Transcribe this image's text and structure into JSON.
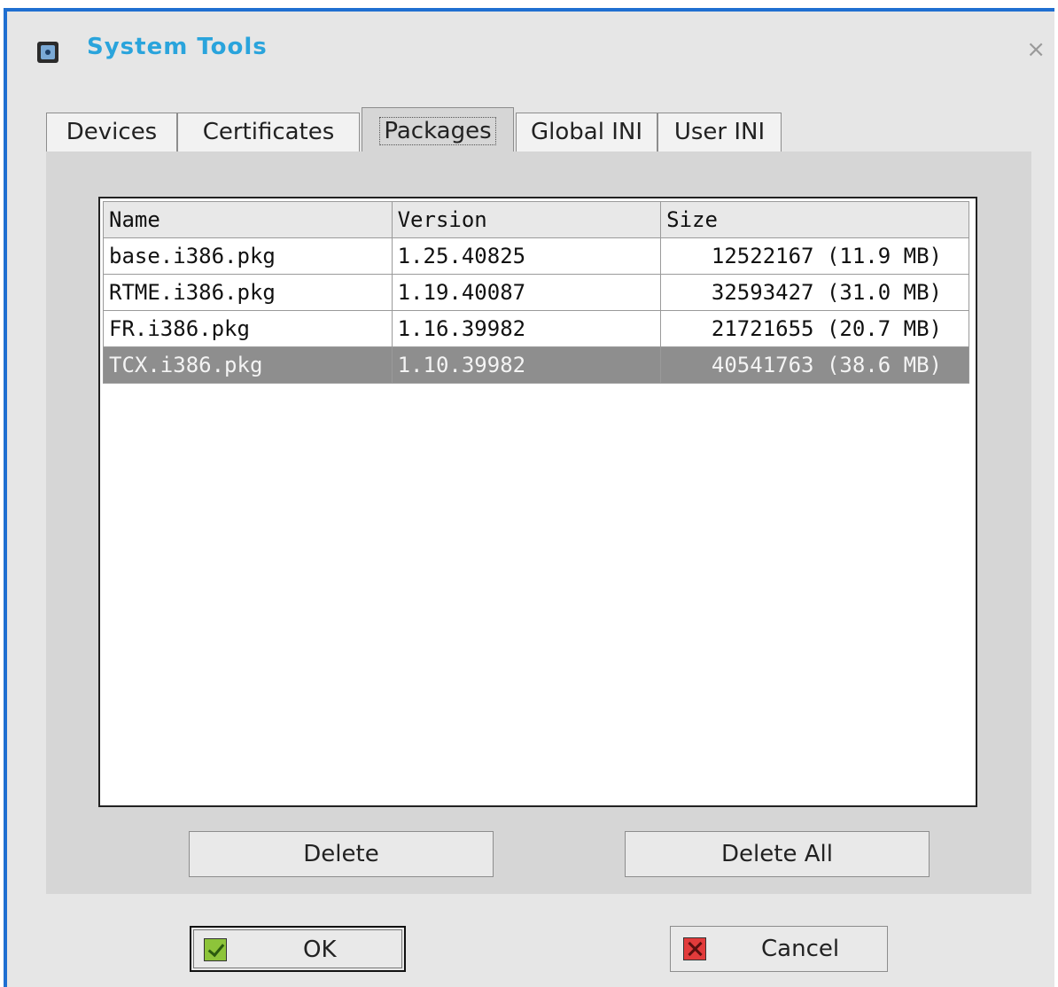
{
  "window": {
    "title": "System Tools",
    "close_symbol": "×"
  },
  "tabs": [
    {
      "label": "Devices",
      "active": false
    },
    {
      "label": "Certificates",
      "active": false
    },
    {
      "label": "Packages",
      "active": true
    },
    {
      "label": "Global INI",
      "active": false
    },
    {
      "label": "User INI",
      "active": false
    }
  ],
  "packages_table": {
    "columns": [
      "Name",
      "Version",
      "Size"
    ],
    "rows": [
      {
        "name": "base.i386.pkg",
        "version": "1.25.40825",
        "size": "12522167 (11.9 MB)",
        "selected": false
      },
      {
        "name": "RTME.i386.pkg",
        "version": "1.19.40087",
        "size": "32593427 (31.0 MB)",
        "selected": false
      },
      {
        "name": "FR.i386.pkg",
        "version": "1.16.39982",
        "size": "21721655 (20.7 MB)",
        "selected": false
      },
      {
        "name": "TCX.i386.pkg",
        "version": "1.10.39982",
        "size": "40541763 (38.6 MB)",
        "selected": true
      }
    ]
  },
  "actions": {
    "delete_label": "Delete",
    "delete_all_label": "Delete All"
  },
  "footer": {
    "ok_label": "OK",
    "cancel_label": "Cancel"
  },
  "colors": {
    "accent_border": "#1f6fd1",
    "title_text": "#2aa4dc",
    "selected_row": "#8e8e8e"
  }
}
